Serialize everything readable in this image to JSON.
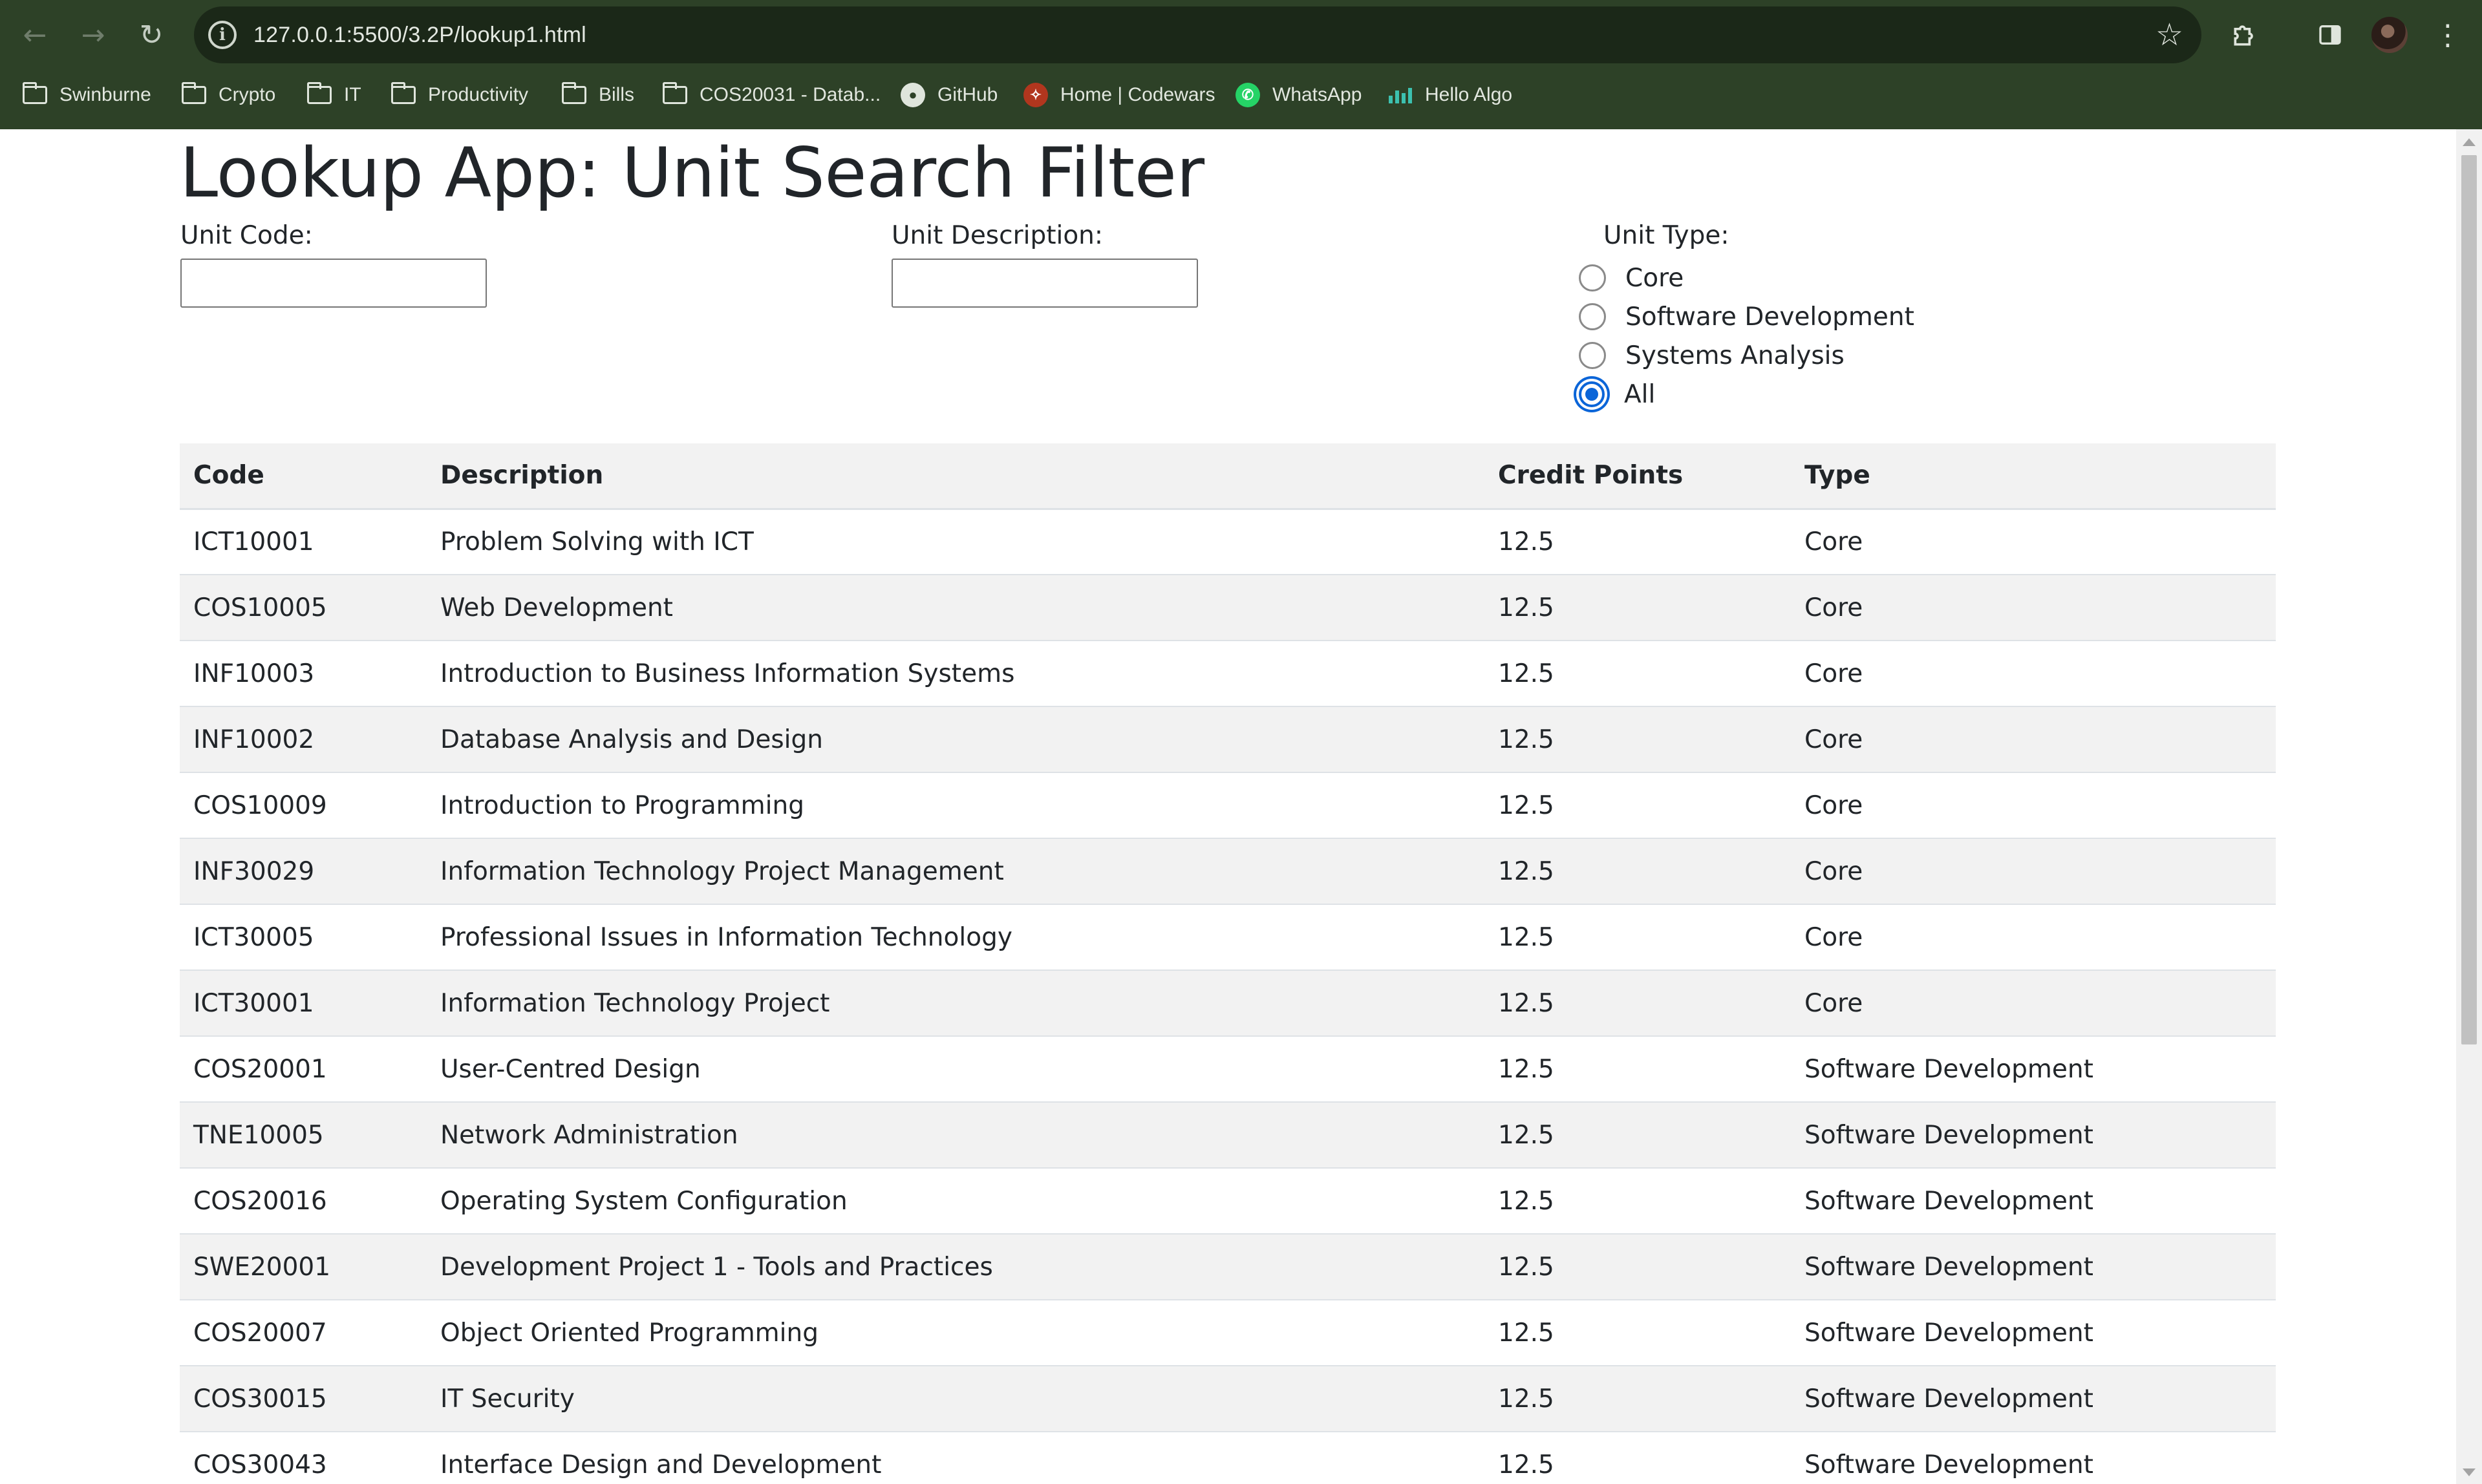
{
  "browser": {
    "url": "127.0.0.1:5500/3.2P/lookup1.html",
    "bookmarks": [
      {
        "label": "Swinburne",
        "icon": "folder-icon"
      },
      {
        "label": "Crypto",
        "icon": "folder-icon"
      },
      {
        "label": "IT",
        "icon": "folder-icon"
      },
      {
        "label": "Productivity",
        "icon": "folder-icon"
      },
      {
        "label": "Bills",
        "icon": "folder-icon"
      },
      {
        "label": "COS20031 - Datab...",
        "icon": "folder-icon"
      },
      {
        "label": "GitHub",
        "icon": "github-icon"
      },
      {
        "label": "Home | Codewars",
        "icon": "codewars-icon"
      },
      {
        "label": "WhatsApp",
        "icon": "whatsapp-icon"
      },
      {
        "label": "Hello Algo",
        "icon": "hello-algo-icon"
      }
    ]
  },
  "page": {
    "title": "Lookup App: Unit Search Filter",
    "unit_code_label": "Unit Code:",
    "unit_code_value": "",
    "unit_description_label": "Unit Description:",
    "unit_description_value": "",
    "unit_type_label": "Unit Type:",
    "unit_type_options": [
      "Core",
      "Software Development",
      "Systems Analysis",
      "All"
    ],
    "unit_type_selected": "All"
  },
  "table": {
    "headers": [
      "Code",
      "Description",
      "Credit Points",
      "Type"
    ],
    "rows": [
      [
        "ICT10001",
        "Problem Solving with ICT",
        "12.5",
        "Core"
      ],
      [
        "COS10005",
        "Web Development",
        "12.5",
        "Core"
      ],
      [
        "INF10003",
        "Introduction to Business Information Systems",
        "12.5",
        "Core"
      ],
      [
        "INF10002",
        "Database Analysis and Design",
        "12.5",
        "Core"
      ],
      [
        "COS10009",
        "Introduction to Programming",
        "12.5",
        "Core"
      ],
      [
        "INF30029",
        "Information Technology Project Management",
        "12.5",
        "Core"
      ],
      [
        "ICT30005",
        "Professional Issues in Information Technology",
        "12.5",
        "Core"
      ],
      [
        "ICT30001",
        "Information Technology Project",
        "12.5",
        "Core"
      ],
      [
        "COS20001",
        "User-Centred Design",
        "12.5",
        "Software Development"
      ],
      [
        "TNE10005",
        "Network Administration",
        "12.5",
        "Software Development"
      ],
      [
        "COS20016",
        "Operating System Configuration",
        "12.5",
        "Software Development"
      ],
      [
        "SWE20001",
        "Development Project 1 - Tools and Practices",
        "12.5",
        "Software Development"
      ],
      [
        "COS20007",
        "Object Oriented Programming",
        "12.5",
        "Software Development"
      ],
      [
        "COS30015",
        "IT Security",
        "12.5",
        "Software Development"
      ],
      [
        "COS30043",
        "Interface Design and Development",
        "12.5",
        "Software Development"
      ]
    ]
  },
  "colors": {
    "chrome_bg": "#2d4127",
    "omnibox_bg": "#1b2818",
    "radio_accent": "#0b65d8",
    "row_stripe": "#f2f2f2"
  }
}
